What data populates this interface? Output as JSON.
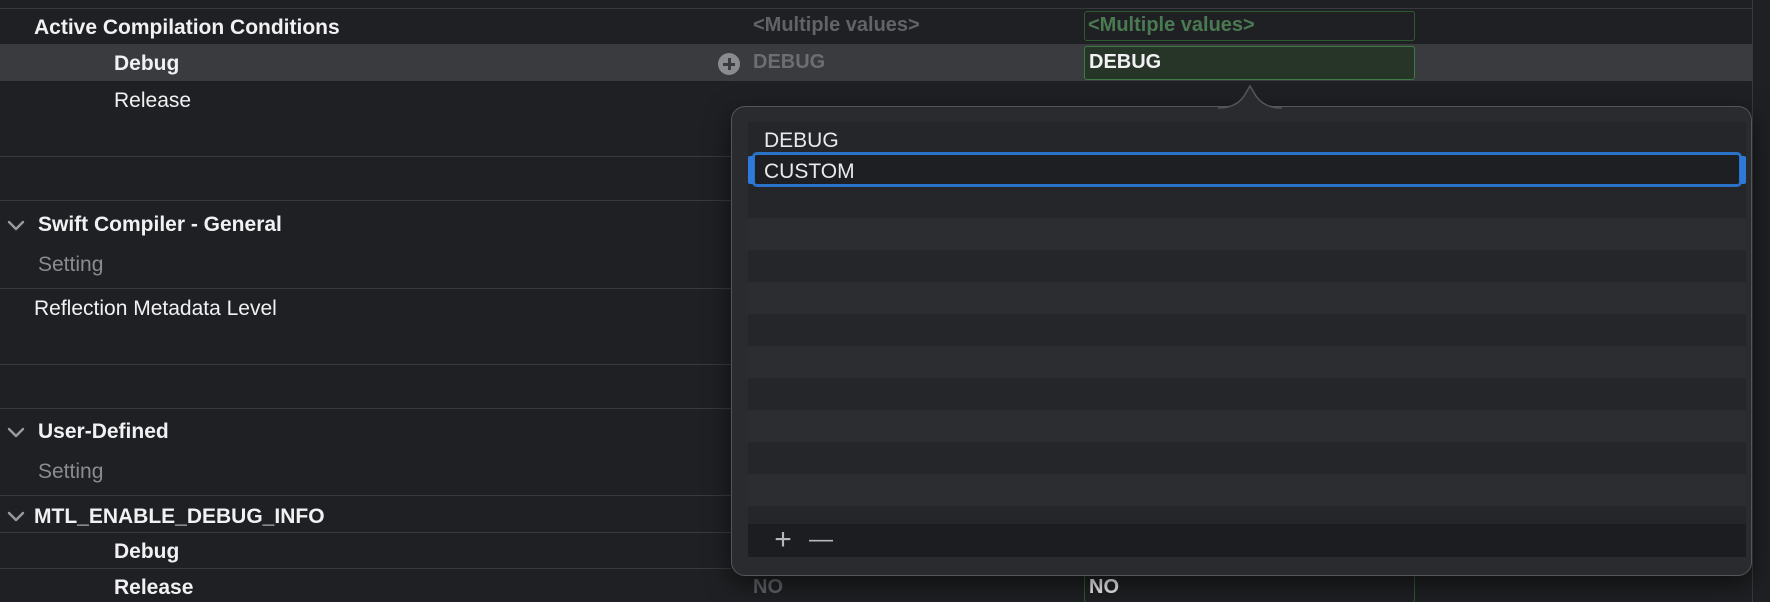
{
  "sections": {
    "active_compilation_conditions": {
      "title": "Active Compilation Conditions",
      "resolved_value": "<Multiple values>",
      "target_value": "<Multiple values>",
      "debug": {
        "label": "Debug",
        "resolved_value": "DEBUG",
        "target_value": "DEBUG"
      },
      "release": {
        "label": "Release"
      }
    },
    "swift_compiler_general": {
      "title": "Swift Compiler - General",
      "column_header": "Setting",
      "setting_reflection": "Reflection Metadata Level"
    },
    "user_defined": {
      "title": "User-Defined",
      "column_header": "Setting"
    },
    "mtl_enable_debug_info": {
      "title": "MTL_ENABLE_DEBUG_INFO",
      "debug": {
        "label": "Debug"
      },
      "release": {
        "label": "Release",
        "resolved_value": "NO",
        "target_value": "NO"
      }
    }
  },
  "popover": {
    "items": [
      "DEBUG"
    ],
    "editing_value": "CUSTOM",
    "add_label": "+",
    "remove_label": "—"
  },
  "colors": {
    "background": "#1f2023",
    "row_highlight": "#3a3b3f",
    "selection_accent": "#2a72c8",
    "value_box_border": "#3d7a45"
  },
  "icons": {
    "section_toggle": "chevron-down-icon",
    "add_value": "plus-circle-icon"
  }
}
